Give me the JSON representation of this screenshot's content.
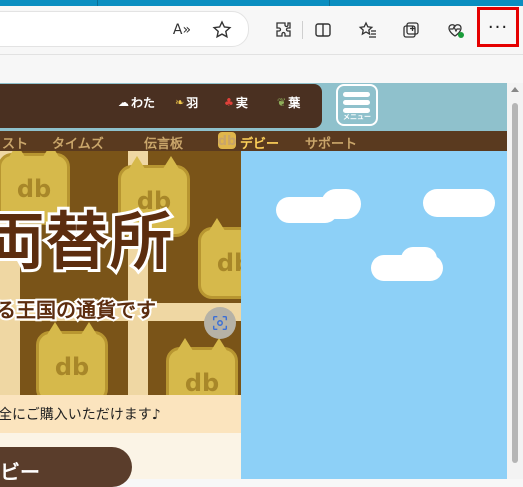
{
  "browser": {
    "menu_label": "···",
    "read_aloud_icon": "A»"
  },
  "site": {
    "currencies": [
      {
        "icon": "cotton-icon",
        "label": "わた"
      },
      {
        "icon": "feather-icon",
        "label": "羽"
      },
      {
        "icon": "fruit-icon",
        "label": "実"
      },
      {
        "icon": "leaf-icon",
        "label": "葉"
      }
    ],
    "menu_label": "メニュー",
    "nav": [
      "スト",
      "タイムズ",
      "伝言板",
      "デビー",
      "サポート"
    ],
    "nav_badge": "db",
    "banner_title": "両替所",
    "banner_subtitle": "る王国の通貨です",
    "coin_text": "db",
    "notice": "全にご購入いただけます♪",
    "section_pill": "ビー"
  },
  "colors": {
    "accent_red": "#e50000",
    "header_bg": "#8fc1cc",
    "panel_brown": "#4a3021",
    "nav_bg": "#5a3a1f",
    "nav_active": "#ffd25a",
    "sky": "#8dd0f7"
  }
}
